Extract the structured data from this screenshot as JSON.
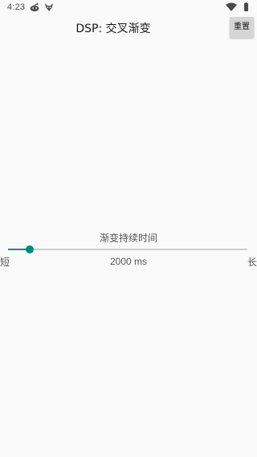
{
  "status_bar": {
    "time": "4:23",
    "left_icons": [
      "reddit-icon",
      "bug-icon"
    ],
    "right_icons": [
      "wifi-icon",
      "battery-icon"
    ]
  },
  "header": {
    "title": "DSP: 交叉渐变",
    "reset_label": "重置"
  },
  "slider": {
    "label": "渐变持续时间",
    "min_label": "短",
    "max_label": "长",
    "value_text": "2000 ms",
    "fraction": 0.09,
    "accent_color": "#00897b",
    "track_color": "#cfcfcf"
  }
}
